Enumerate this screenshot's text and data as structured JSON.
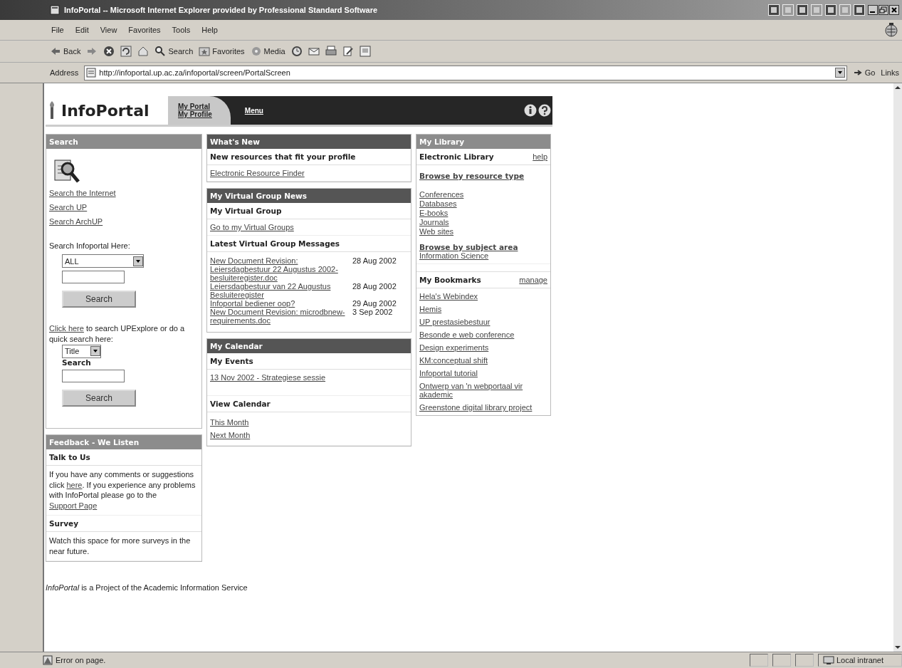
{
  "window": {
    "title": "InfoPortal -- Microsoft Internet Explorer provided by Professional Standard Software"
  },
  "menu_bar": [
    "File",
    "Edit",
    "View",
    "Favorites",
    "Tools",
    "Help"
  ],
  "toolbar": [
    {
      "kind": "back",
      "label": "Back"
    },
    {
      "kind": "forward"
    },
    {
      "kind": "stop"
    },
    {
      "kind": "refresh"
    },
    {
      "kind": "home"
    },
    {
      "kind": "search",
      "label": "Search"
    },
    {
      "kind": "favorites",
      "label": "Favorites"
    },
    {
      "kind": "media",
      "label": "Media"
    },
    {
      "kind": "history"
    },
    {
      "kind": "mail"
    },
    {
      "kind": "print"
    },
    {
      "kind": "edit"
    },
    {
      "kind": "discuss"
    }
  ],
  "address_bar": {
    "label": "Address",
    "url": "http://infoportal.up.ac.za/infoportal/screen/PortalScreen",
    "go": "Go",
    "links": "Links"
  },
  "header": {
    "logo": "InfoPortal",
    "tabs": [
      {
        "links": [
          "My Portal",
          "My Profile"
        ],
        "selected": true
      },
      {
        "links": [
          "Menu"
        ],
        "selected": false
      }
    ]
  },
  "search_panel": {
    "title": "Search",
    "links": [
      "Search the Internet",
      "Search UP",
      "Search ArchUP"
    ],
    "infoportal_label": "Search Infoportal Here:",
    "scope": "ALL",
    "button": "Search",
    "explore_link": "Click here",
    "explore_text": " to search UPExplore or do a quick search here:",
    "quick_field": "Title",
    "quick_label": "Search",
    "quick_button": "Search"
  },
  "feedback_panel": {
    "title": "Feedback - We Listen",
    "sections": [
      {
        "heading": "Talk to Us",
        "parts": [
          {
            "kind": "text",
            "text": "If you have any comments or suggestions click "
          },
          {
            "kind": "link",
            "text": "here"
          },
          {
            "kind": "text",
            "text": ". If you experience any problems with InfoPortal please go to the "
          },
          {
            "kind": "link",
            "text": "Support Page"
          }
        ]
      },
      {
        "heading": "Survey",
        "parts": [
          {
            "kind": "text",
            "text": "Watch this space for more surveys in the near future."
          }
        ]
      }
    ]
  },
  "whats_new": {
    "title": "What's New",
    "heading": "New resources that fit your profile",
    "link": "Electronic Resource Finder"
  },
  "virtual_group_news": {
    "title": "My Virtual Group News",
    "heading": "My Virtual Group",
    "link": "Go to my Virtual Groups",
    "messages_heading": "Latest Virtual Group Messages",
    "messages": [
      {
        "subject": "New Document Revision: Leiersdagbestuur 22 Augustus 2002-besluiteregister.doc",
        "date": "28 Aug 2002"
      },
      {
        "subject": "Leiersdagbestuur van 22 Augustus Besluiteregister",
        "date": "28 Aug 2002"
      },
      {
        "subject": "Infoportal bediener oop?",
        "date": "29 Aug 2002"
      },
      {
        "subject": "New Document Revision: microdbnew-requirements.doc",
        "date": "3 Sep 2002"
      }
    ]
  },
  "calendar": {
    "title": "My Calendar",
    "events_heading": "My Events",
    "events": [
      "13 Nov 2002 - Strategiese sessie"
    ],
    "view_heading": "View Calendar",
    "view_links": [
      "This Month",
      "Next Month"
    ]
  },
  "library": {
    "title": "My Library",
    "heading": "Electronic Library",
    "help": "help",
    "browse_resource": "Browse by resource type",
    "resources": [
      "Conferences",
      "Databases",
      "E-books",
      "Journals",
      "Web sites"
    ],
    "browse_subject": "Browse by subject area",
    "subjects": [
      "Information Science"
    ]
  },
  "bookmarks": {
    "title": "My Bookmarks",
    "manage": "manage",
    "items": [
      "Hela's Webindex",
      "Hemis",
      "UP prestasiebestuur",
      "Besonde e web conference",
      "Design experiments",
      "KM:conceptual shift",
      "Infoportal tutorial",
      "Ontwerp van 'n webportaal vir akademic",
      "Greenstone digital library project"
    ]
  },
  "footer": "*InfoPortal* is a Project of the Academic Information Service",
  "status_bar": {
    "message": "Error on page.",
    "zone": "Local intranet"
  }
}
